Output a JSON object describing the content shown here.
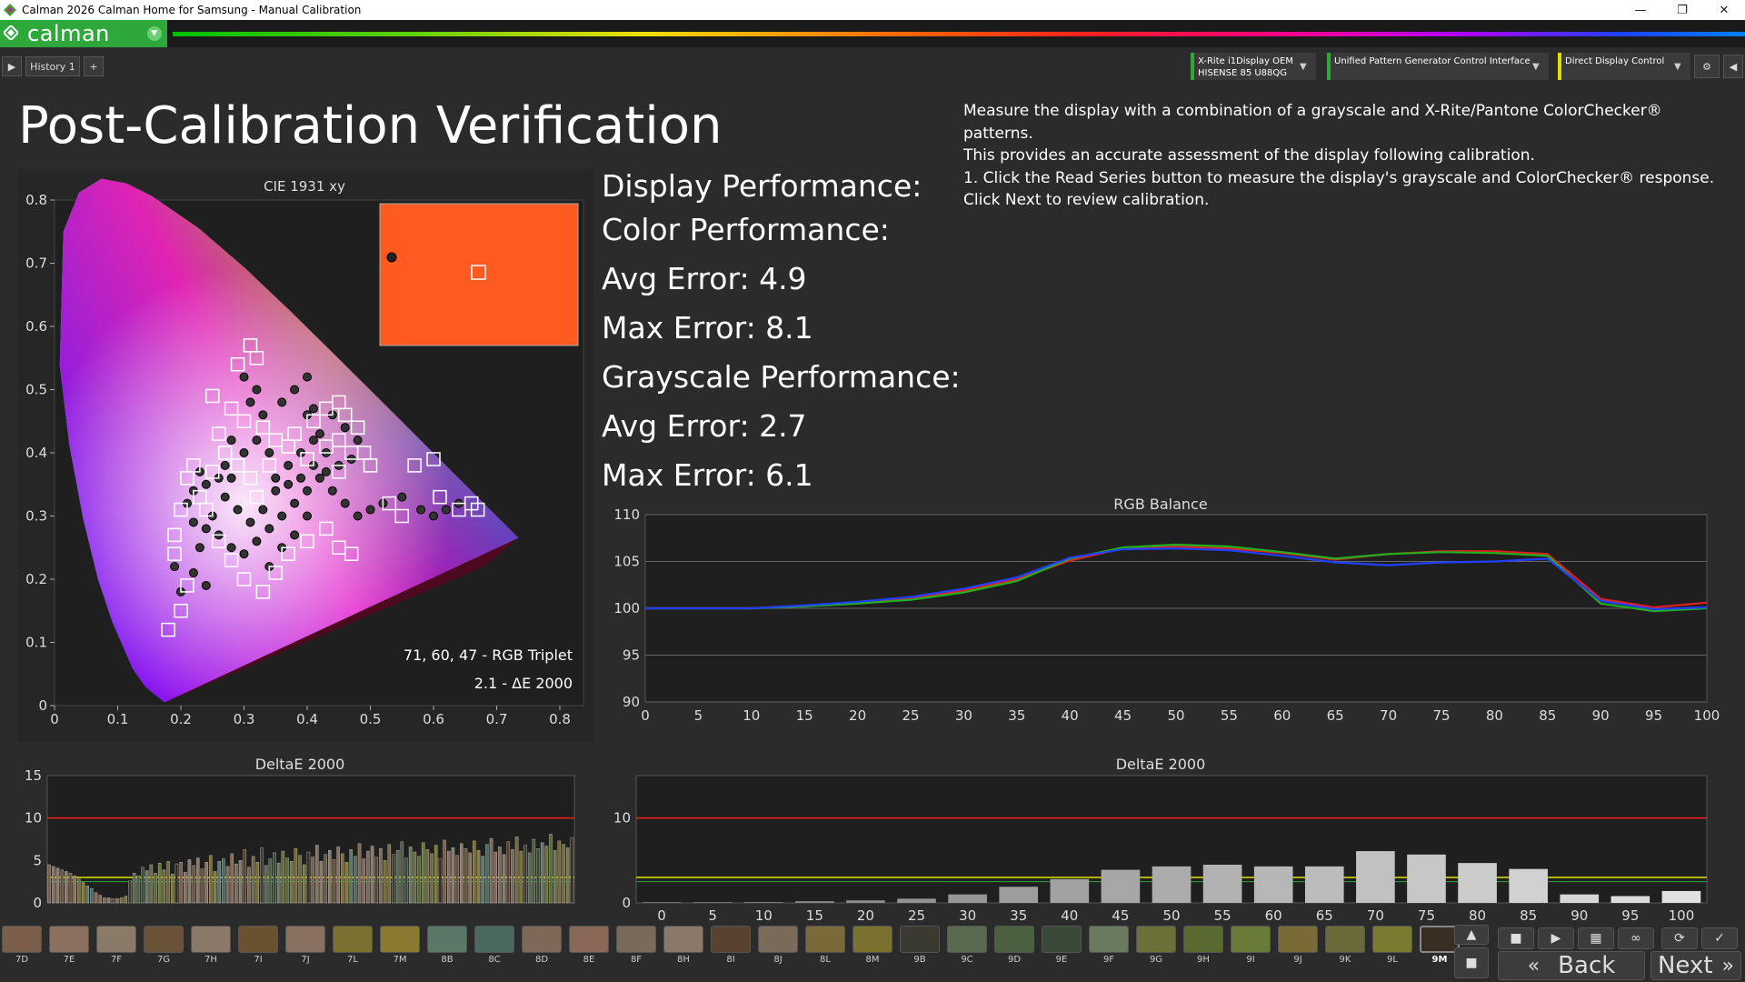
{
  "window": {
    "title": "Calman 2026 Calman Home for Samsung  - Manual Calibration",
    "minimize": "—",
    "restore": "❐",
    "close": "✕"
  },
  "app": {
    "logo_text": "calman",
    "logo_dropdown": "▼"
  },
  "tabs": {
    "play": "▶",
    "history": "History 1",
    "add": "+"
  },
  "devices": [
    {
      "line1": "X-Rite i1Display OEM",
      "line2": "HISENSE 85 U88QG",
      "status_color": "#2ea83b"
    },
    {
      "line1": "Unified Pattern Generator Control Interface",
      "line2": "",
      "status_color": "#2ea83b"
    },
    {
      "line1": "Direct Display Control",
      "line2": "",
      "status_color": "#e0e000"
    }
  ],
  "page": {
    "title": "Post-Calibration Verification",
    "instructions": [
      "Measure the display with a combination of a grayscale and X-Rite/Pantone ColorChecker® patterns.",
      "This provides an accurate assessment of the display following calibration.",
      "1. Click the Read Series button to measure the display's grayscale and ColorChecker® response.",
      "Click Next to review calibration."
    ]
  },
  "performance": {
    "display": "Display Performance:",
    "color": "Color Performance:",
    "color_avg": "Avg Error: 4.9",
    "color_max": "Max Error: 8.1",
    "grayscale": "Grayscale Performance:",
    "gray_avg": "Avg Error: 2.7",
    "gray_max": "Max Error: 6.1"
  },
  "cie": {
    "title": "CIE 1931 xy",
    "x_ticks": [
      "0",
      "0.1",
      "0.2",
      "0.3",
      "0.4",
      "0.5",
      "0.6",
      "0.7",
      "0.8"
    ],
    "y_ticks": [
      "0",
      "0.1",
      "0.2",
      "0.3",
      "0.4",
      "0.5",
      "0.6",
      "0.7",
      "0.8"
    ],
    "triplet": "71, 60, 47 - RGB Triplet",
    "delta": "2.1 - ΔE 2000",
    "swatch_color": "#ff5a20"
  },
  "chart_data": [
    {
      "type": "line",
      "title": "RGB Balance",
      "x": [
        0,
        5,
        10,
        15,
        20,
        25,
        30,
        35,
        40,
        45,
        50,
        55,
        60,
        65,
        70,
        75,
        80,
        85,
        90,
        95,
        100
      ],
      "ylim": [
        90,
        110
      ],
      "y_ticks": [
        90,
        95,
        100,
        105,
        110
      ],
      "series": [
        {
          "color": "#e02020",
          "values": [
            100,
            100,
            100,
            100.3,
            100.6,
            101.1,
            101.9,
            103.1,
            105.1,
            106.4,
            106.6,
            106.4,
            105.9,
            105.2,
            105.8,
            106.1,
            106.1,
            105.8,
            101,
            100.1,
            100.6
          ]
        },
        {
          "color": "#20b020",
          "values": [
            100,
            100,
            100,
            100.2,
            100.5,
            100.9,
            101.7,
            102.9,
            105.3,
            106.5,
            106.8,
            106.6,
            106.0,
            105.3,
            105.8,
            106.0,
            105.9,
            105.6,
            100.5,
            99.7,
            100.0
          ]
        },
        {
          "color": "#2040ff",
          "values": [
            100,
            100,
            100,
            100.3,
            100.7,
            101.2,
            102.1,
            103.3,
            105.4,
            106.3,
            106.4,
            106.2,
            105.6,
            104.9,
            104.6,
            104.9,
            105.0,
            105.3,
            100.8,
            99.9,
            100.1
          ]
        }
      ]
    },
    {
      "type": "bar",
      "title": "DeltaE 2000",
      "categories": [
        "0",
        "5",
        "10",
        "15",
        "20",
        "25",
        "30",
        "35",
        "40",
        "45",
        "50",
        "55",
        "60",
        "65",
        "70",
        "75",
        "80",
        "85",
        "90",
        "95",
        "100"
      ],
      "values": [
        0.1,
        0.1,
        0.1,
        0.2,
        0.3,
        0.5,
        1.0,
        1.9,
        2.8,
        3.9,
        4.3,
        4.5,
        4.3,
        4.3,
        6.1,
        5.7,
        4.7,
        4.0,
        1.0,
        0.8,
        1.4
      ],
      "ylim": [
        0,
        15
      ],
      "y_ticks": [
        0,
        10
      ],
      "thresholds": [
        {
          "value": 10,
          "color": "#ff2020"
        },
        {
          "value": 3,
          "color": "#e0e000"
        }
      ]
    },
    {
      "type": "bar",
      "title": "DeltaE 2000",
      "values": [
        4.5,
        4.3,
        4.1,
        3.9,
        3.7,
        3.5,
        3.2,
        2.8,
        2.4,
        2.0,
        1.7,
        1.2,
        0.9,
        0.6,
        0.6,
        0.5,
        0.5,
        0.6,
        0.8,
        2.6,
        3.5,
        3.2,
        4.2,
        3.8,
        4.5,
        3.5,
        4.7,
        3.9,
        4.9,
        3.4,
        4.6,
        4.8,
        3.6,
        5.1,
        4.4,
        5.3,
        4.0,
        4.8,
        5.6,
        3.7,
        4.9,
        5.2,
        4.3,
        5.8,
        4.6,
        5.0,
        6.3,
        4.2,
        5.5,
        4.8,
        6.5,
        4.4,
        5.2,
        5.9,
        4.7,
        6.1,
        5.3,
        4.9,
        6.4,
        5.6,
        4.5,
        6.0,
        5.4,
        6.8,
        4.9,
        5.7,
        6.2,
        5.1,
        6.6,
        5.8,
        4.8,
        6.3,
        5.5,
        7.0,
        5.2,
        6.1,
        6.7,
        5.4,
        6.4,
        5.0,
        6.9,
        5.7,
        6.2,
        7.2,
        5.3,
        6.6,
        6.0,
        5.5,
        7.1,
        6.3,
        5.8,
        6.8,
        5.2,
        7.4,
        6.1,
        6.5,
        5.6,
        7.0,
        6.4,
        5.9,
        7.3,
        6.2,
        5.5,
        6.9,
        7.6,
        6.0,
        6.6,
        5.7,
        7.2,
        6.3,
        7.8,
        6.1,
        6.8,
        5.9,
        7.5,
        6.4,
        7.1,
        6.7,
        8.1,
        6.2,
        7.3,
        6.9,
        6.5,
        7.7
      ],
      "ylim": [
        0,
        15
      ],
      "y_ticks": [
        0,
        5,
        10,
        15
      ],
      "thresholds": [
        {
          "value": 10,
          "color": "#ff2020"
        },
        {
          "value": 3,
          "color": "#e0e000"
        }
      ]
    }
  ],
  "swatches": [
    {
      "label": "7D",
      "color": "#7a5e4a"
    },
    {
      "label": "7E",
      "color": "#8b7060"
    },
    {
      "label": "7F",
      "color": "#8a7a68"
    },
    {
      "label": "7G",
      "color": "#6a5238"
    },
    {
      "label": "7H",
      "color": "#8a7868"
    },
    {
      "label": "7I",
      "color": "#6a5230"
    },
    {
      "label": "7J",
      "color": "#8a7060"
    },
    {
      "label": "7L",
      "color": "#7a7030"
    },
    {
      "label": "7M",
      "color": "#8a7a30"
    },
    {
      "label": "8B",
      "color": "#5a7868"
    },
    {
      "label": "8C",
      "color": "#4a6a60"
    },
    {
      "label": "8D",
      "color": "#806858"
    },
    {
      "label": "8E",
      "color": "#8a6858"
    },
    {
      "label": "8F",
      "color": "#7a6a5a"
    },
    {
      "label": "8H",
      "color": "#8a7868"
    },
    {
      "label": "8I",
      "color": "#5a4230"
    },
    {
      "label": "8J",
      "color": "#7a6a5a"
    },
    {
      "label": "8L",
      "color": "#7a6a3a"
    },
    {
      "label": "8M",
      "color": "#7a7030"
    },
    {
      "label": "9B",
      "color": "#3a3a30"
    },
    {
      "label": "9C",
      "color": "#5a6a50"
    },
    {
      "label": "9D",
      "color": "#4a6040"
    },
    {
      "label": "9E",
      "color": "#3a4a38"
    },
    {
      "label": "9F",
      "color": "#6a7a60"
    },
    {
      "label": "9G",
      "color": "#6a7038"
    },
    {
      "label": "9H",
      "color": "#5a6a30"
    },
    {
      "label": "9I",
      "color": "#6a7a38"
    },
    {
      "label": "9J",
      "color": "#7a6a38"
    },
    {
      "label": "9K",
      "color": "#6a6a38"
    },
    {
      "label": "9L",
      "color": "#7a7a30"
    },
    {
      "label": "9M",
      "color": "#3a2e24"
    }
  ],
  "controls": {
    "back": "Back",
    "next": "Next",
    "back_icon": "«",
    "next_icon": "»"
  },
  "colors": {
    "accent": "#2ea83b",
    "panel": "#262626"
  }
}
